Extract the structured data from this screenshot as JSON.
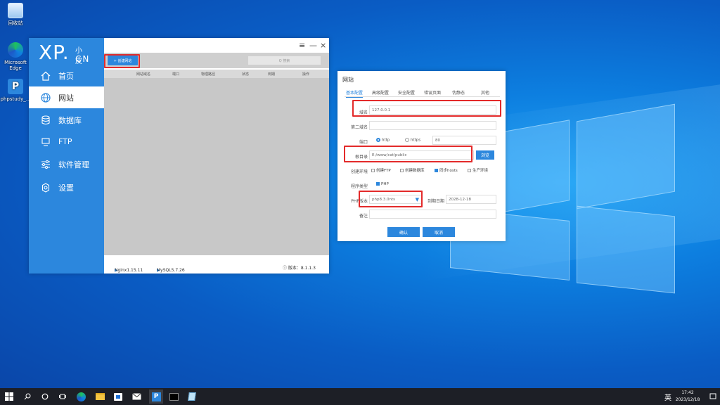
{
  "desktop": {
    "icons": [
      {
        "label": "回收站"
      },
      {
        "label": "Microsoft Edge"
      },
      {
        "label": "phpstudy_..."
      }
    ]
  },
  "app": {
    "logo": {
      "xp": "XP.",
      "cn_top": "小皮",
      "cn_bottom": "CN"
    },
    "nav": [
      {
        "label": "首页",
        "icon": "home-icon"
      },
      {
        "label": "网站",
        "icon": "globe-icon"
      },
      {
        "label": "数据库",
        "icon": "database-icon"
      },
      {
        "label": "FTP",
        "icon": "ftp-icon"
      },
      {
        "label": "软件管理",
        "icon": "sliders-icon"
      },
      {
        "label": "设置",
        "icon": "gear-icon"
      }
    ],
    "window_controls": {
      "menu": "≡",
      "minimize": "—",
      "close": "×"
    },
    "toolbar": {
      "create_label": "+ 创建网站",
      "search_placeholder": "Q 搜索"
    },
    "table_headers": [
      "网站域名",
      "端口",
      "物理路径",
      "状态",
      "到期",
      "操作"
    ],
    "status": {
      "nginx": "Nginx1.15.11",
      "mysql": "MySQL5.7.26",
      "version": "ⓘ 版本：8.1.1.3"
    }
  },
  "dialog": {
    "title": "网站",
    "tabs": [
      "基本配置",
      "高级配置",
      "安全配置",
      "错误页面",
      "伪静态",
      "其他"
    ],
    "domain_label": "域名",
    "domain_value": "127.0.0.1",
    "second_domain_label": "第二域名",
    "port_label": "端口",
    "http_label": "http",
    "https_label": "https",
    "port_value": "80",
    "root_label": "根目录",
    "root_value": "E:/www/cat/public",
    "browse_label": "浏览",
    "env_label": "创建环境",
    "env_options": [
      {
        "label": "创建FTP",
        "checked": false
      },
      {
        "label": "创建数据库",
        "checked": false
      },
      {
        "label": "同步hosts",
        "checked": true
      },
      {
        "label": "生产环境",
        "checked": false
      }
    ],
    "program_label": "程序类型",
    "program_value": "PHP",
    "php_label": "PHP版本",
    "php_value": "php8.3.0nts",
    "expire_label": "到期日期",
    "expire_value": "2028-12-18",
    "note_label": "备注",
    "confirm_label": "确认",
    "cancel_label": "取消"
  },
  "taskbar": {
    "ime": "英",
    "time": "17:42",
    "date": "2023/12/18"
  },
  "colors": {
    "accent": "#2c87dd",
    "highlight": "#e32a2a"
  }
}
